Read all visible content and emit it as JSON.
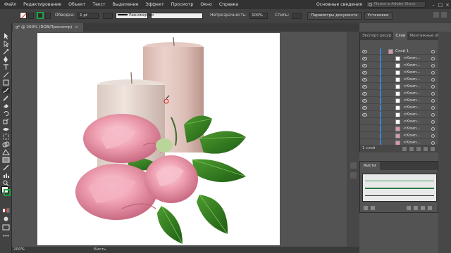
{
  "menu": {
    "items": [
      "Файл",
      "Редактирование",
      "Объект",
      "Текст",
      "Выделение",
      "Эффект",
      "Просмотр",
      "Окно",
      "Справка"
    ],
    "workspace": "Основные сведения",
    "search_placeholder": "Поиск в Adobe Stock"
  },
  "control_bar": {
    "stroke_label": "Обводка:",
    "stroke_weight": "1 pt",
    "brush_name": "Равномерная",
    "opacity_label": "Непрозрачность:",
    "opacity_value": "100%",
    "style_label": "Стиль:",
    "doc_setup_button": "Параметры документа",
    "prefs_button": "Установки"
  },
  "document": {
    "tab_title": "g* @ 200% (RGB/Просмотр)",
    "close_glyph": "×"
  },
  "status": {
    "zoom": "200%",
    "tool": "Кисть"
  },
  "layers_panel": {
    "tabs": [
      "Экспорт ресур",
      "Слои",
      "Монтажные об"
    ],
    "active_tab": "Слои",
    "top_layer": "Слой 1",
    "sublayers": [
      "<Комп...",
      "<Комп...",
      "<Комп...",
      "<Комп...",
      "<Комп...",
      "<Комп...",
      "<Комп...",
      "<Комп...",
      "<Комп...",
      "<Комп...",
      "<Комп...",
      "<Комп...",
      "<Комп...",
      "<Комп..."
    ],
    "footer": "1 слой"
  },
  "brushes_panel": {
    "title": "Кисти"
  },
  "colors": {
    "app_bg": "#535353",
    "menu_bg": "#323232",
    "selection_blue": "#3b86d6",
    "stroke_green": "#1fa044"
  }
}
